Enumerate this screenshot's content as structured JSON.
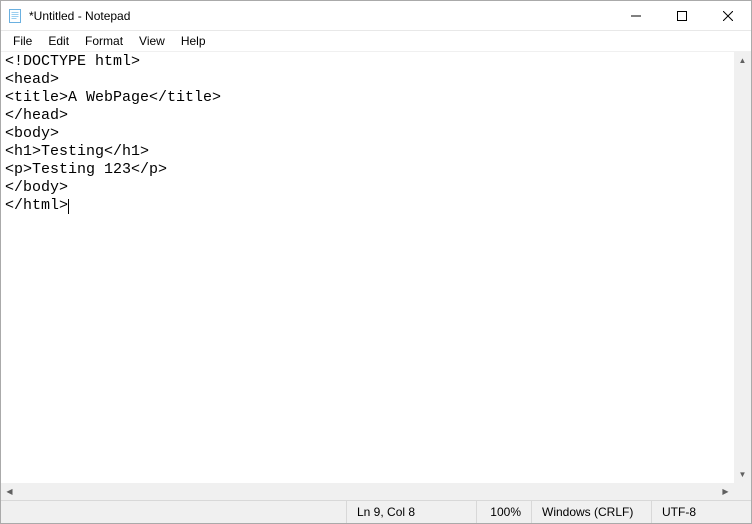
{
  "window": {
    "title": "*Untitled - Notepad"
  },
  "menu": {
    "items": [
      "File",
      "Edit",
      "Format",
      "View",
      "Help"
    ]
  },
  "editor": {
    "lines": [
      "<!DOCTYPE html>",
      "<head>",
      "<title>A WebPage</title>",
      "</head>",
      "<body>",
      "<h1>Testing</h1>",
      "<p>Testing 123</p>",
      "</body>",
      "</html>"
    ],
    "caret_line": 8,
    "caret_after_last": true
  },
  "status": {
    "position": "Ln 9, Col 8",
    "zoom": "100%",
    "line_ending": "Windows (CRLF)",
    "encoding": "UTF-8"
  }
}
